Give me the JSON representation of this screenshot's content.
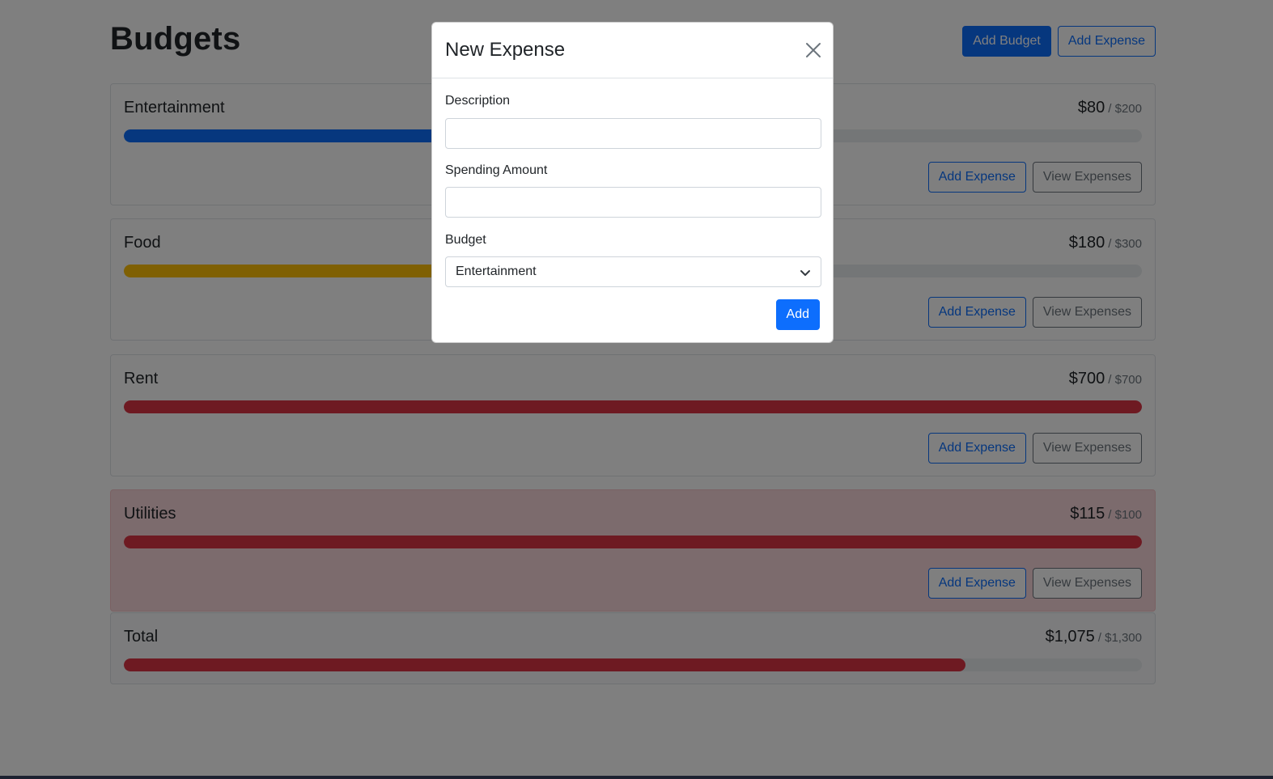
{
  "header": {
    "title": "Budgets",
    "add_budget_label": "Add Budget",
    "add_expense_label": "Add Expense"
  },
  "budgets": [
    {
      "name": "Entertainment",
      "amount": "$80",
      "max": "/ $200",
      "progress": 0.4,
      "bar_color": "#0d6efd",
      "variant": "default",
      "add_label": "Add Expense",
      "view_label": "View Expenses"
    },
    {
      "name": "Food",
      "amount": "$180",
      "max": "/ $300",
      "progress": 0.6,
      "bar_color": "#ffc107",
      "variant": "default",
      "add_label": "Add Expense",
      "view_label": "View Expenses"
    },
    {
      "name": "Rent",
      "amount": "$700",
      "max": "/ $700",
      "progress": 1.0,
      "bar_color": "#dc3545",
      "variant": "default",
      "add_label": "Add Expense",
      "view_label": "View Expenses"
    },
    {
      "name": "Utilities",
      "amount": "$115",
      "max": "/ $100",
      "progress": 1.0,
      "bar_color": "#dc3545",
      "variant": "danger",
      "add_label": "Add Expense",
      "view_label": "View Expenses"
    }
  ],
  "total": {
    "name": "Total",
    "amount": "$1,075",
    "max": "/ $1,300",
    "progress": 0.827,
    "bar_color": "#dc3545"
  },
  "modal": {
    "title": "New Expense",
    "description_label": "Description",
    "description_value": "",
    "amount_label": "Spending Amount",
    "amount_value": "",
    "budget_label": "Budget",
    "budget_selected": "Entertainment",
    "submit_label": "Add"
  },
  "icons": {
    "close": "close-icon",
    "select": "chevron-down-icon"
  }
}
